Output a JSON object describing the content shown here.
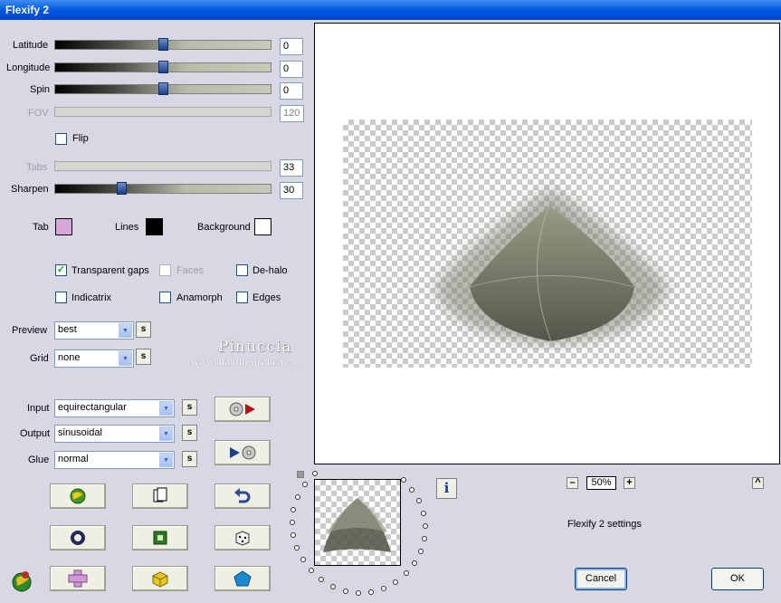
{
  "window": {
    "title": "Flexify 2"
  },
  "sliders": [
    {
      "label": "Latitude",
      "value": "0",
      "level": 0.5,
      "enabled": true
    },
    {
      "label": "Longitude",
      "value": "0",
      "level": 0.5,
      "enabled": true
    },
    {
      "label": "Spin",
      "value": "0",
      "level": 0.5,
      "enabled": true
    },
    {
      "label": "FOV",
      "value": "120",
      "enabled": false
    },
    {
      "label": "Tabs",
      "value": "33",
      "enabled": false
    },
    {
      "label": "Sharpen",
      "value": "30",
      "level": 0.3,
      "enabled": true
    }
  ],
  "flip": {
    "label": "Flip",
    "checked": false
  },
  "colors": {
    "tab": {
      "label": "Tab",
      "color": "#d9a6d8"
    },
    "lines": {
      "label": "Lines",
      "color": "#000000"
    },
    "background": {
      "label": "Background",
      "color": "#ffffff"
    }
  },
  "options": {
    "transparent_gaps": {
      "label": "Transparent gaps",
      "checked": true
    },
    "faces": {
      "label": "Faces",
      "checked": false,
      "enabled": false
    },
    "de_halo": {
      "label": "De-halo",
      "checked": false
    },
    "indicatrix": {
      "label": "Indicatrix",
      "checked": false
    },
    "anamorph": {
      "label": "Anamorph",
      "checked": false
    },
    "edges": {
      "label": "Edges",
      "checked": false
    }
  },
  "preview": {
    "label": "Preview",
    "value": "best"
  },
  "grid": {
    "label": "Grid",
    "value": "none"
  },
  "watermark": {
    "name": "Pinuccia",
    "url": "www.maidiregrafica.eu"
  },
  "projection": {
    "input": {
      "label": "Input",
      "value": "equirectangular"
    },
    "output": {
      "label": "Output",
      "value": "sinusoidal"
    },
    "glue": {
      "label": "Glue",
      "value": "normal"
    }
  },
  "lock_button_label": "s",
  "zoom": {
    "value": "50%",
    "minus": "–",
    "plus": "+"
  },
  "status_text": "Flexify 2 settings",
  "buttons": {
    "cancel": "Cancel",
    "ok": "OK",
    "info": "i",
    "up": "^"
  },
  "accent_colors": {
    "titlebar": "#0054e3",
    "dialog_bg": "#d8d7e4",
    "thumb": "#1b3f8a"
  }
}
